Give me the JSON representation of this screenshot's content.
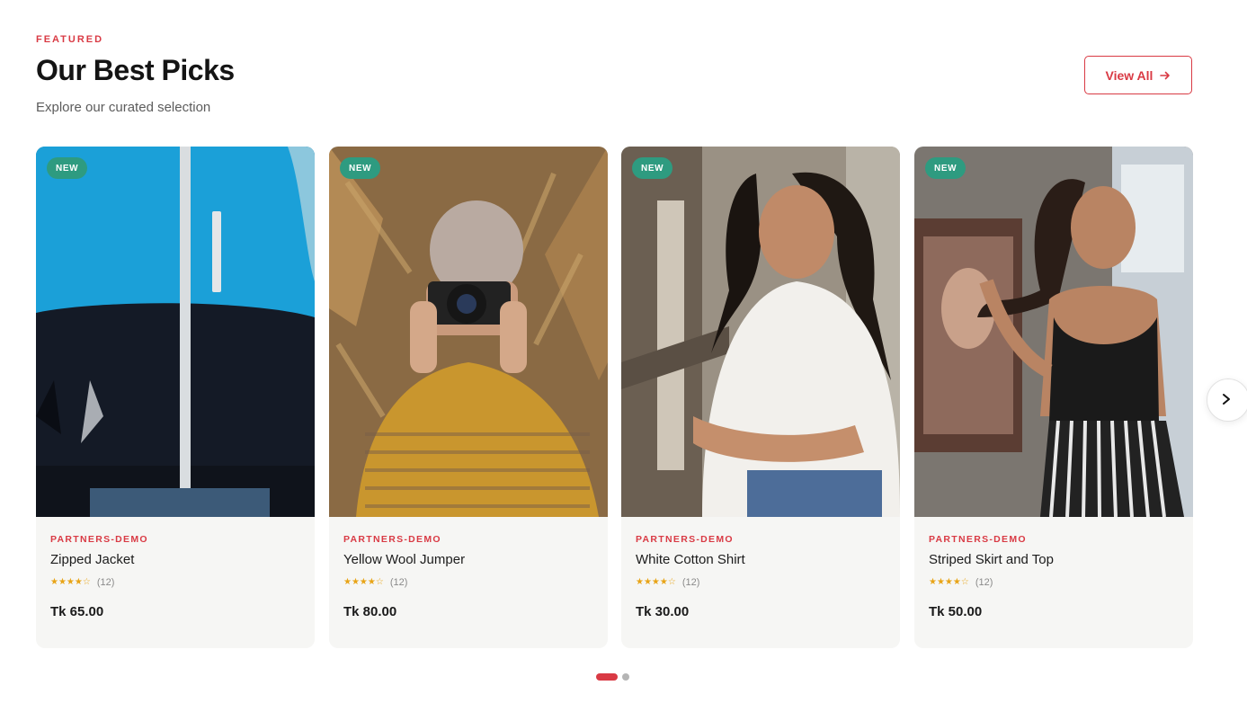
{
  "section": {
    "eyebrow": "FEATURED",
    "title": "Our Best Picks",
    "subtitle": "Explore our curated selection",
    "view_all_label": "View All"
  },
  "colors": {
    "accent": "#d93a44",
    "badge": "#2e9b80",
    "star": "#e8a416",
    "card_bg": "#f6f6f4"
  },
  "products": [
    {
      "badge": "NEW",
      "vendor": "PARTNERS-DEMO",
      "name": "Zipped Jacket",
      "rating": 4.5,
      "stars": "★★★★☆",
      "reviews": "(12)",
      "price": "Tk 65.00"
    },
    {
      "badge": "NEW",
      "vendor": "PARTNERS-DEMO",
      "name": "Yellow Wool Jumper",
      "rating": 4.5,
      "stars": "★★★★☆",
      "reviews": "(12)",
      "price": "Tk 80.00"
    },
    {
      "badge": "NEW",
      "vendor": "PARTNERS-DEMO",
      "name": "White Cotton Shirt",
      "rating": 4.5,
      "stars": "★★★★☆",
      "reviews": "(12)",
      "price": "Tk 30.00"
    },
    {
      "badge": "NEW",
      "vendor": "PARTNERS-DEMO",
      "name": "Striped Skirt and Top",
      "rating": 4.5,
      "stars": "★★★★☆",
      "reviews": "(12)",
      "price": "Tk 50.00"
    }
  ],
  "carousel": {
    "next_icon": "chevron-right-icon",
    "pages": 2,
    "active_page": 1
  }
}
